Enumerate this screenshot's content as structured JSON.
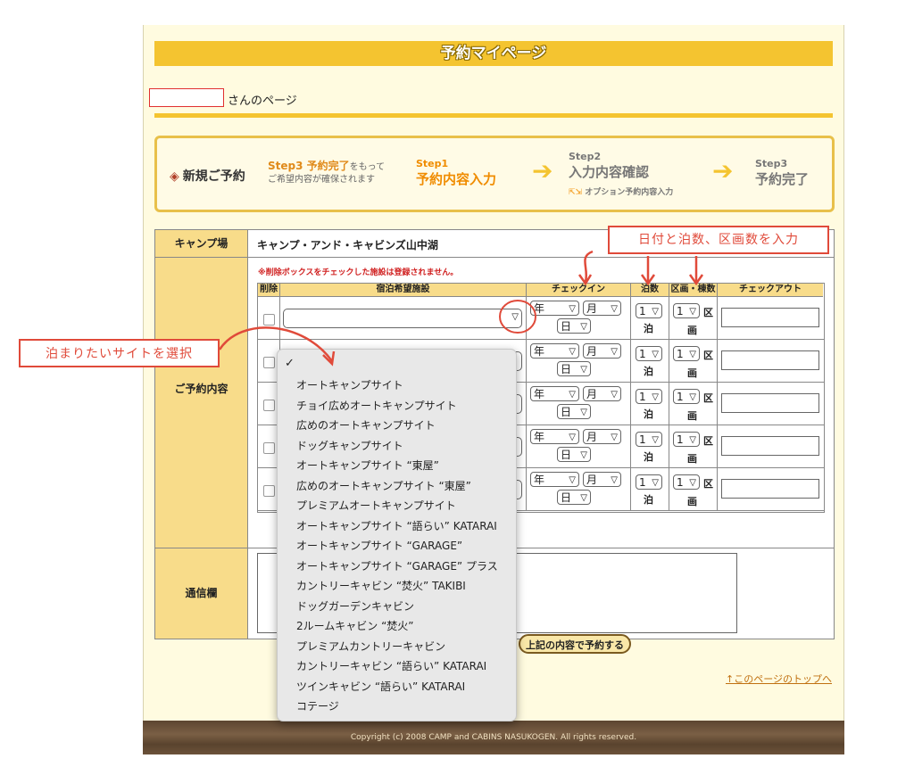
{
  "header": {
    "title": "予約マイページ",
    "name_suffix": "さんのページ"
  },
  "steps": {
    "new": "新規ご予約",
    "note_orange": "Step3 予約完了",
    "note_tail": "をもって",
    "note_line2": "ご希望内容が確保されます",
    "step1_label": "Step1",
    "step1_title": "予約内容入力",
    "step2_label": "Step2",
    "step2_title": "入力内容確認",
    "step2_option": "オプション予約内容入力",
    "step3_label": "Step3",
    "step3_title": "予約完了"
  },
  "form": {
    "camp_label": "キャンプ場",
    "camp_value": "キャンプ・アンド・キャビンズ山中湖",
    "reservation_label": "ご予約内容",
    "warning": "※削除ボックスをチェックした施設は登録されません。",
    "columns": [
      "削除",
      "宿泊希望施設",
      "チェックイン",
      "泊数",
      "区画・棟数",
      "チェックアウト"
    ],
    "year": "年",
    "month": "月",
    "day": "日",
    "nights_value": "1",
    "nights_unit": "泊",
    "units_value": "1",
    "units_unit_top": "区",
    "units_unit_bottom": "画",
    "message_label": "通信欄",
    "submit": "上記の内容で予約する",
    "top_link": "↑このページのトップへ"
  },
  "dropdown": {
    "options": [
      "オートキャンプサイト",
      "チョイ広めオートキャンプサイト",
      "広めのオートキャンプサイト",
      "ドッグキャンプサイト",
      "オートキャンプサイト “東屋”",
      "広めのオートキャンプサイト “東屋”",
      "プレミアムオートキャンプサイト",
      "オートキャンプサイト “語らい” KATARAI",
      "オートキャンプサイト “GARAGE”",
      "オートキャンプサイト “GARAGE” プラス",
      "カントリーキャビン “焚火” TAKIBI",
      "ドッグガーデンキャビン",
      "2ルームキャビン “焚火”",
      "プレミアムカントリーキャビン",
      "カントリーキャビン “語らい” KATARAI",
      "ツインキャビン “語らい” KATARAI",
      "コテージ"
    ]
  },
  "annotations": {
    "left": "泊まりたいサイトを選択",
    "right": "日付と泊数、区画数を入力"
  },
  "footer": {
    "copyright": "Copyright (c) 2008 CAMP and CABINS NASUKOGEN. All rights reserved."
  }
}
